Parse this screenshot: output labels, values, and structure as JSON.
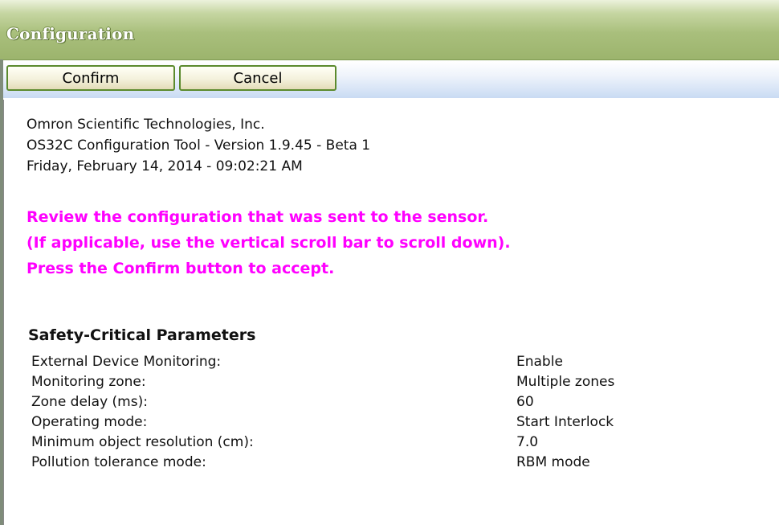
{
  "window": {
    "title": "Configuration"
  },
  "toolbar": {
    "confirm_label": "Confirm",
    "cancel_label": "Cancel"
  },
  "info": {
    "company": "Omron Scientific Technologies, Inc.",
    "tool": "OS32C Configuration Tool - Version 1.9.45 - Beta 1",
    "datetime": "Friday, February 14, 2014  -  09:02:21 AM"
  },
  "notice": {
    "line1": "Review the configuration that was sent to the sensor.",
    "line2": "(If applicable, use the vertical scroll bar to scroll down).",
    "line3": "Press the Confirm button to accept.",
    "color": "#ff00ff"
  },
  "section": {
    "title": "Safety-Critical Parameters"
  },
  "params": [
    {
      "label": "External Device Monitoring:",
      "value": "Enable"
    },
    {
      "label": "Monitoring zone:",
      "value": "Multiple zones"
    },
    {
      "label": "Zone delay (ms):",
      "value": "60"
    },
    {
      "label": "Operating mode:",
      "value": "Start Interlock"
    },
    {
      "label": "Minimum object resolution (cm):",
      "value": "7.0"
    },
    {
      "label": "Pollution tolerance mode:",
      "value": "RBM mode"
    }
  ]
}
